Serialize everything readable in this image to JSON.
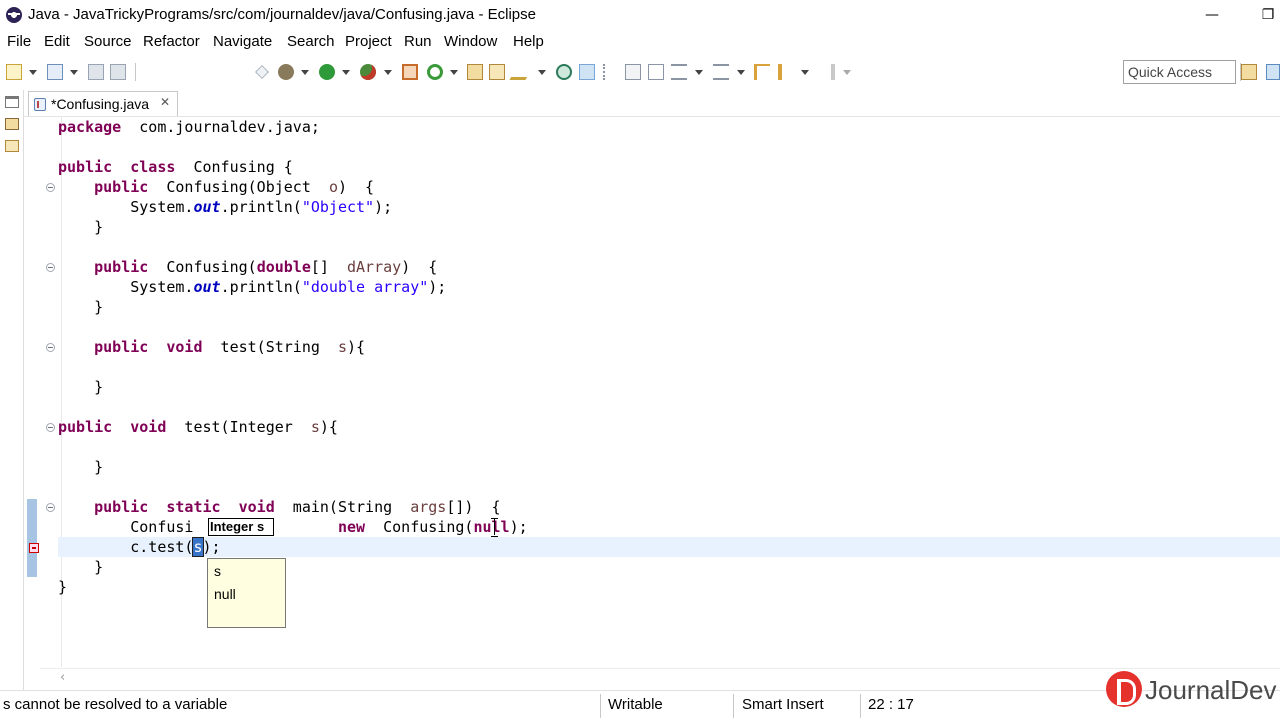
{
  "window": {
    "title": "Java - JavaTrickyPrograms/src/com/journaldev/java/Confusing.java - Eclipse",
    "minimize": "—",
    "maximize": "❐"
  },
  "menu": {
    "items": [
      "File",
      "Edit",
      "Source",
      "Refactor",
      "Navigate",
      "Search",
      "Project",
      "Run",
      "Window",
      "Help"
    ]
  },
  "toolbar": {
    "quick_access_label": "Quick Access"
  },
  "editor": {
    "tab_label": "*Confusing.java",
    "tab_close": "✕",
    "line_tokens": [
      [
        [
          "kw",
          "package"
        ],
        [
          "",
          "  com.journaldev.java;"
        ]
      ],
      [],
      [
        [
          "kw",
          "public"
        ],
        [
          "",
          "  "
        ],
        [
          "kw",
          "class"
        ],
        [
          "",
          "  Confusing {"
        ]
      ],
      [
        [
          "",
          "    "
        ],
        [
          "kw",
          "public"
        ],
        [
          "",
          "  Confusing(Object  "
        ],
        [
          "par",
          "o"
        ],
        [
          "",
          ")  {"
        ]
      ],
      [
        [
          "",
          "        System."
        ],
        [
          "fld",
          "out"
        ],
        [
          "",
          ".println("
        ],
        [
          "str",
          "\"Object\""
        ],
        [
          "",
          ");"
        ]
      ],
      [
        [
          "",
          "    }"
        ]
      ],
      [],
      [
        [
          "",
          "    "
        ],
        [
          "kw",
          "public"
        ],
        [
          "",
          "  Confusing("
        ],
        [
          "kw",
          "double"
        ],
        [
          "",
          "[]  "
        ],
        [
          "par",
          "dArray"
        ],
        [
          "",
          ")  {"
        ]
      ],
      [
        [
          "",
          "        System."
        ],
        [
          "fld",
          "out"
        ],
        [
          "",
          ".println("
        ],
        [
          "str",
          "\"double array\""
        ],
        [
          "",
          ");"
        ]
      ],
      [
        [
          "",
          "    }"
        ]
      ],
      [],
      [
        [
          "",
          "    "
        ],
        [
          "kw",
          "public"
        ],
        [
          "",
          "  "
        ],
        [
          "kw",
          "void"
        ],
        [
          "",
          "  test(String  "
        ],
        [
          "par",
          "s"
        ],
        [
          "",
          "){"
        ]
      ],
      [],
      [
        [
          "",
          "    }"
        ]
      ],
      [],
      [
        [
          "kw",
          "public"
        ],
        [
          "",
          "  "
        ],
        [
          "kw",
          "void"
        ],
        [
          "",
          "  test(Integer  "
        ],
        [
          "par",
          "s"
        ],
        [
          "",
          "){"
        ]
      ],
      [],
      [
        [
          "",
          "    }"
        ]
      ],
      [],
      [
        [
          "",
          "    "
        ],
        [
          "kw",
          "public"
        ],
        [
          "",
          "  "
        ],
        [
          "kw",
          "static"
        ],
        [
          "",
          "  "
        ],
        [
          "kw",
          "void"
        ],
        [
          "",
          "  main(String  "
        ],
        [
          "par",
          "args"
        ],
        [
          "",
          "[])  {"
        ]
      ],
      [
        [
          "",
          "        Confusi"
        ],
        [
          "",
          "                "
        ],
        [
          "kw",
          "new"
        ],
        [
          "",
          "  Confusing("
        ],
        [
          "kw",
          "null"
        ],
        [
          "",
          ");"
        ]
      ],
      [
        [
          "",
          "        c.test("
        ],
        [
          "sel",
          "s"
        ],
        [
          "",
          ");"
        ]
      ],
      [
        [
          "",
          "    }"
        ]
      ],
      [
        [
          "",
          "}"
        ]
      ]
    ],
    "hover_hint": "Integer s",
    "proposals": [
      "s",
      "null"
    ]
  },
  "status": {
    "message": "s cannot be resolved to a variable",
    "mode": "Writable",
    "insert_mode": "Smart Insert",
    "position": "22 : 17"
  },
  "branding": {
    "logo_text": "JournalDev"
  }
}
